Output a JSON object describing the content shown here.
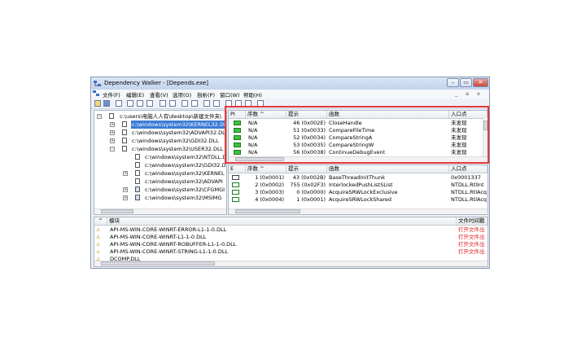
{
  "window": {
    "title": "Dependency Walker - [Depends.exe]",
    "buttons": {
      "minimize": "–",
      "maximize": "▭",
      "close": "✕"
    }
  },
  "menu": [
    "文件(F)",
    "编辑(E)",
    "查看(V)",
    "选项(O)",
    "剖析(P)",
    "窗口(W)",
    "帮助(H)"
  ],
  "menu_right": {
    "minimize": "_",
    "restore": "ə",
    "close": "x"
  },
  "tree": {
    "root": "c:\\users\\电脑人人有\\desktop\\新建文件夹\\",
    "items": [
      {
        "label": "c:\\windows\\system32\\KERNEL32.DLL",
        "selected": true
      },
      {
        "label": "c:\\windows\\system32\\ADVAPI32.DLL"
      },
      {
        "label": "c:\\windows\\system32\\GDI32.DLL"
      },
      {
        "label": "c:\\windows\\system32\\USER32.DLL"
      },
      {
        "label": "c:\\windows\\system32\\NTDLL.D"
      },
      {
        "label": "c:\\windows\\system32\\GDI32.D"
      },
      {
        "label": "c:\\windows\\system32\\KERNEL"
      },
      {
        "label": "c:\\windows\\system32\\ADVAPI"
      },
      {
        "label": "c:\\windows\\system32\\CFGMGI"
      },
      {
        "label": "c:\\windows\\system32\\MSIMG"
      }
    ]
  },
  "imports": {
    "headers": [
      "PI",
      "序数 ^",
      "提示",
      "函数",
      "入口点"
    ],
    "rows": [
      {
        "ordinal": "N/A",
        "hint": "46 (0x002E)",
        "function": "CloseHandle",
        "entry": "未发现"
      },
      {
        "ordinal": "N/A",
        "hint": "51 (0x0033)",
        "function": "CompareFileTime",
        "entry": "未发现"
      },
      {
        "ordinal": "N/A",
        "hint": "52 (0x0034)",
        "function": "CompareStringA",
        "entry": "未发现"
      },
      {
        "ordinal": "N/A",
        "hint": "53 (0x0035)",
        "function": "CompareStringW",
        "entry": "未发现"
      },
      {
        "ordinal": "N/A",
        "hint": "56 (0x0038)",
        "function": "ContinueDebugEvent",
        "entry": "未发现"
      }
    ]
  },
  "exports": {
    "headers": [
      "E",
      "序数 ^",
      "提示",
      "函数",
      "入口点"
    ],
    "rows": [
      {
        "ordinal": "1 (0x0001)",
        "hint": "43 (0x002B)",
        "function": "BaseThreadInitThunk",
        "entry": "0x0001337"
      },
      {
        "ordinal": "2 (0x0002)",
        "hint": "755 (0x02F3)",
        "function": "InterlockedPushListSList",
        "entry": "NTDLL.RtlInt"
      },
      {
        "ordinal": "3 (0x0003)",
        "hint": "0 (0x0000)",
        "function": "AcquireSRWLockExclusive",
        "entry": "NTDLL.RtlAcq"
      },
      {
        "ordinal": "4 (0x0004)",
        "hint": "1 (0x0001)",
        "function": "AcquireSRWLockShared",
        "entry": "NTDLL.RtlAcq"
      }
    ]
  },
  "modules": {
    "headers": [
      "^",
      "模块",
      "文件时间戳"
    ],
    "rows": [
      {
        "name": "API-MS-WIN-CORE-WINRT-ERROR-L1-1-0.DLL",
        "status": "打开文件出"
      },
      {
        "name": "API-MS-WIN-CORE-WINRT-L1-1-0.DLL",
        "status": "打开文件出"
      },
      {
        "name": "API-MS-WIN-CORE-WINRT-ROBUFFER-L1-1-0.DLL",
        "status": "打开文件出"
      },
      {
        "name": "API-MS-WIN-CORE-WINRT-STRING-L1-1-0.DLL",
        "status": "打开文件出"
      },
      {
        "name": "DCOMP.DLL",
        "status": ""
      }
    ]
  },
  "colors": {
    "highlight": "#e5383b",
    "selection": "#3b7bd6",
    "ok_icon": "#3fbf3f"
  }
}
